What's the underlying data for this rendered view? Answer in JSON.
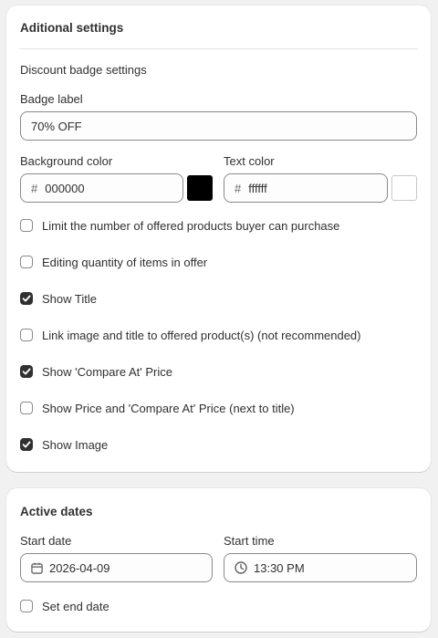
{
  "additional": {
    "title": "Aditional settings",
    "section_label": "Discount badge settings",
    "badge_label": "Badge label",
    "badge_value": "70% OFF",
    "bg_color_label": "Background color",
    "bg_color_value": "000000",
    "bg_color_hex": "#000000",
    "text_color_label": "Text color",
    "text_color_value": "ffffff",
    "text_color_hex": "#ffffff",
    "hash": "#",
    "checkboxes": [
      {
        "label": "Limit the number of offered products buyer can purchase",
        "checked": false
      },
      {
        "label": "Editing quantity of items in offer",
        "checked": false
      },
      {
        "label": "Show Title",
        "checked": true
      },
      {
        "label": "Link image and title to offered product(s) (not recommended)",
        "checked": false
      },
      {
        "label": "Show 'Compare At' Price",
        "checked": true
      },
      {
        "label": "Show Price and 'Compare At' Price (next to title)",
        "checked": false
      },
      {
        "label": "Show Image",
        "checked": true
      }
    ]
  },
  "active_dates": {
    "title": "Active dates",
    "start_date_label": "Start date",
    "start_date_value": "2026-04-09",
    "start_time_label": "Start time",
    "start_time_value": "13:30 PM",
    "end_date_label": "Set end date",
    "end_date_checked": false
  },
  "icons": {
    "calendar": "calendar-icon",
    "clock": "clock-icon",
    "check": "checkmark-icon"
  }
}
